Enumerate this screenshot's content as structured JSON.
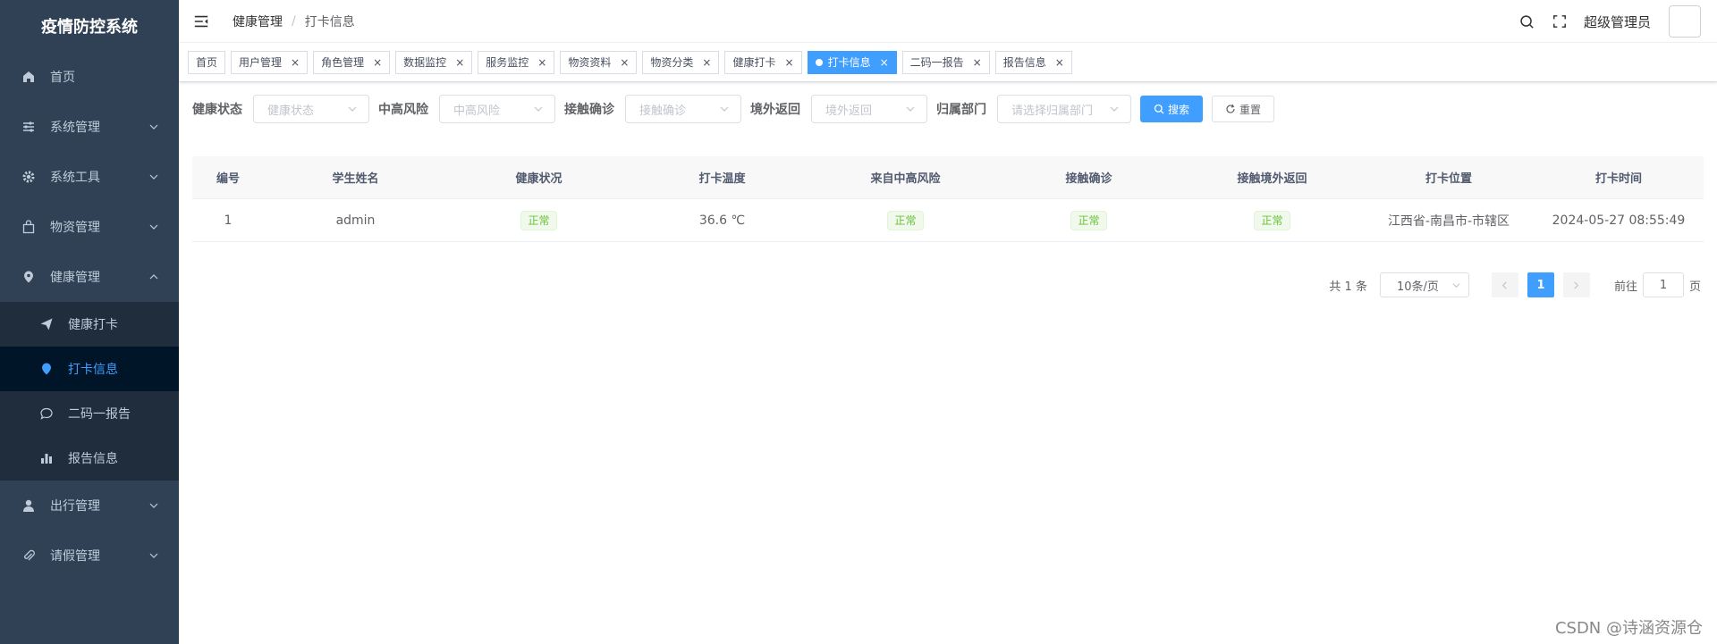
{
  "app": {
    "title": "疫情防控系统"
  },
  "sidebar": {
    "items": [
      {
        "label": "首页",
        "icon": "home-icon"
      },
      {
        "label": "系统管理",
        "icon": "sliders-icon"
      },
      {
        "label": "系统工具",
        "icon": "gear-icon"
      },
      {
        "label": "物资管理",
        "icon": "bag-icon"
      },
      {
        "label": "健康管理",
        "icon": "location-icon",
        "expanded": true
      },
      {
        "label": "出行管理",
        "icon": "user-icon"
      },
      {
        "label": "请假管理",
        "icon": "paperclip-icon"
      }
    ],
    "health_sub": [
      {
        "label": "健康打卡",
        "icon": "paper-plane-icon"
      },
      {
        "label": "打卡信息",
        "icon": "map-pin-icon",
        "active": true
      },
      {
        "label": "二码一报告",
        "icon": "chat-bubble-icon"
      },
      {
        "label": "报告信息",
        "icon": "bar-chart-icon"
      }
    ]
  },
  "navbar": {
    "breadcrumb": [
      "健康管理",
      "打卡信息"
    ],
    "breadcrumb_sep": "/",
    "username": "超级管理员"
  },
  "tags": [
    {
      "label": "首页",
      "closable": false
    },
    {
      "label": "用户管理",
      "closable": true
    },
    {
      "label": "角色管理",
      "closable": true
    },
    {
      "label": "数据监控",
      "closable": true
    },
    {
      "label": "服务监控",
      "closable": true
    },
    {
      "label": "物资资料",
      "closable": true
    },
    {
      "label": "物资分类",
      "closable": true
    },
    {
      "label": "健康打卡",
      "closable": true
    },
    {
      "label": "打卡信息",
      "closable": true,
      "active": true
    },
    {
      "label": "二码一报告",
      "closable": true
    },
    {
      "label": "报告信息",
      "closable": true
    }
  ],
  "tag_close_glyph": "×",
  "filters": {
    "health_status": {
      "label": "健康状态",
      "placeholder": "健康状态"
    },
    "risk": {
      "label": "中高风险",
      "placeholder": "中高风险"
    },
    "contact": {
      "label": "接触确诊",
      "placeholder": "接触确诊"
    },
    "abroad": {
      "label": "境外返回",
      "placeholder": "境外返回"
    },
    "dept": {
      "label": "归属部门",
      "placeholder": "请选择归属部门"
    },
    "search_label": "搜索",
    "reset_label": "重置"
  },
  "table": {
    "columns": [
      "编号",
      "学生姓名",
      "健康状况",
      "打卡温度",
      "来自中高风险",
      "接触确诊",
      "接触境外返回",
      "打卡位置",
      "打卡时间"
    ],
    "rows": [
      {
        "id": "1",
        "name": "admin",
        "health": "正常",
        "temp": "36.6 ℃",
        "risk": "正常",
        "contact": "正常",
        "abroad": "正常",
        "location": "江西省-南昌市-市辖区",
        "time": "2024-05-27 08:55:49"
      }
    ]
  },
  "pagination": {
    "total": "共 1 条",
    "page_size": "10条/页",
    "current": "1",
    "goto_prefix": "前往",
    "goto_value": "1",
    "goto_suffix": "页"
  },
  "watermark": "CSDN @诗涵资源仓",
  "colors": {
    "sidebar_bg": "#304156",
    "submenu_bg": "#1f2d3d",
    "active_bg": "#001528",
    "accent": "#409eff",
    "success": "#67c23a"
  }
}
